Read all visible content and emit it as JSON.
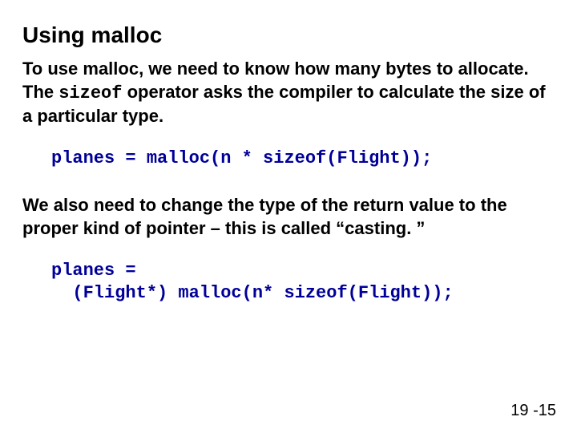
{
  "title": "Using malloc",
  "para1_a": "To use malloc, we need to know how many bytes to allocate.  The ",
  "para1_mono": "sizeof",
  "para1_b": " operator asks the compiler to calculate the size of a particular type.",
  "code1": "planes = malloc(n * sizeof(Flight));",
  "para2": "We also need to change the type of the return value to the proper kind of pointer – this is called “casting. ”",
  "code2": "planes =\n  (Flight*) malloc(n* sizeof(Flight));",
  "pagenum": "19 -15"
}
